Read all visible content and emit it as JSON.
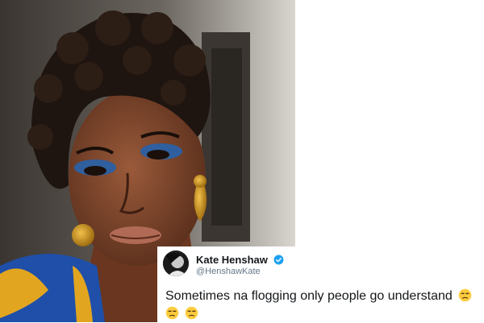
{
  "photo": {
    "icon": "portrait-photo"
  },
  "tweet": {
    "display_name": "Kate Henshaw",
    "handle": "@HenshawKate",
    "verified_icon": "verified-badge-icon",
    "text": "Sometimes na flogging only people go understand",
    "emoji": [
      "unamused-face",
      "unamused-face",
      "unamused-face"
    ],
    "colors": {
      "name": "#14171a",
      "handle": "#657786",
      "verified": "#1da1f2"
    }
  }
}
